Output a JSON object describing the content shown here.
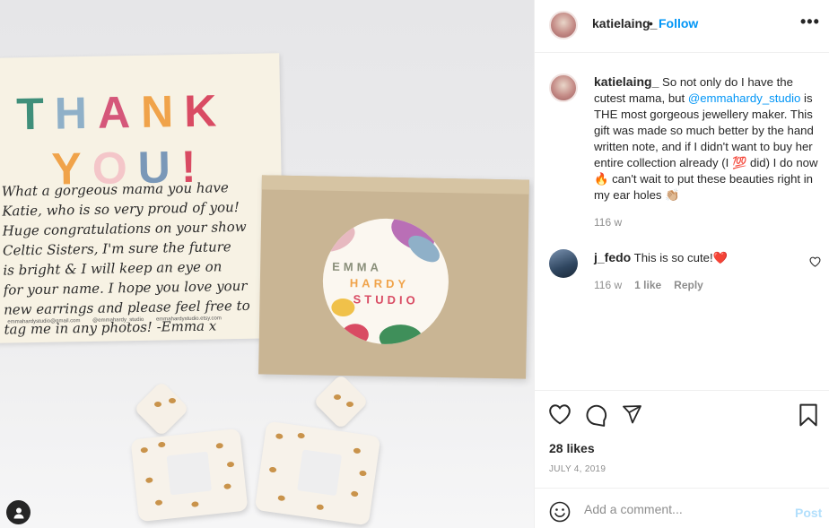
{
  "photo": {
    "card": {
      "thank": [
        "T",
        "H",
        "A",
        "N",
        "K"
      ],
      "thank_colors": [
        "#3f8f7a",
        "#8fb0c8",
        "#d5577a",
        "#f0a34a",
        "#d94b63"
      ],
      "you": [
        "Y",
        "O",
        "U",
        "!"
      ],
      "you_colors": [
        "#f0a34a",
        "#f4c6c9",
        "#7a98b8",
        "#d94b63"
      ],
      "handwriting": "What a gorgeous mama you have\nKatie, who is so very proud of you!\nHuge congratulations on your show\nCeltic Sisters, I'm sure the future\nis bright & I will keep an eye on\nfor your name. I hope you love your\nnew earrings and please feel free to\ntag me in any photos! -Emma x",
      "footer": "emmahardystudio@gmail.com  @emmahardy_studio  emmahardystudio.etsy.com"
    },
    "sticker": {
      "line1": "EMMA",
      "line2": "HARDY",
      "line3": "STUDIO",
      "colors": {
        "emma": "#8a8f7a",
        "hardy": "#f0a34a",
        "studio": "#d94b63"
      }
    }
  },
  "header": {
    "username": "katielaing_",
    "separator": "•",
    "follow_label": "Follow",
    "more_label": "•••"
  },
  "caption": {
    "username": "katielaing_",
    "text_1": " So not only do I have the cutest mama, but ",
    "mention": "@emmahardy_studio",
    "text_2": " is THE most gorgeous jewellery maker. This gift was made so much better by the hand written note, and if I didn't want to buy her entire collection already (I ",
    "emoji_1": "💯",
    "text_3": " did) I do now ",
    "emoji_2": "🔥",
    "text_4": " can't wait to put these beauties right in my ear holes ",
    "emoji_3": "👏🏼",
    "time": "116 w"
  },
  "comment": {
    "username": "j_fedo",
    "text": " This is so cute!",
    "emoji": "❤️",
    "time": "116 w",
    "likes": "1 like",
    "reply": "Reply"
  },
  "actions": {
    "likes": "28 likes",
    "date": "JULY 4, 2019"
  },
  "add_comment": {
    "placeholder": "Add a comment...",
    "post_label": "Post"
  }
}
